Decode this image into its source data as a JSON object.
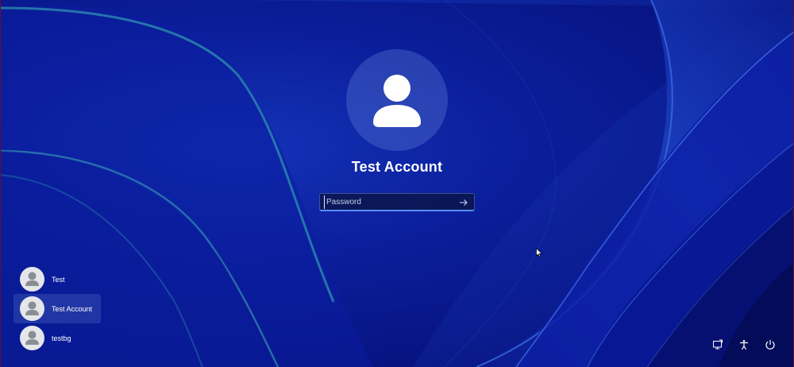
{
  "lock_screen": {
    "selected_user": {
      "name": "Test Account",
      "avatar_icon": "user-avatar-icon"
    },
    "password": {
      "placeholder": "Password",
      "value": "",
      "submit_icon": "arrow-right-icon"
    }
  },
  "user_list": [
    {
      "name": "Test",
      "avatar_icon": "user-avatar-icon",
      "selected": false
    },
    {
      "name": "Test Account",
      "avatar_icon": "user-avatar-icon",
      "selected": true
    },
    {
      "name": "testbg",
      "avatar_icon": "user-avatar-icon",
      "selected": false
    }
  ],
  "system_icons": [
    {
      "icon": "network-icon"
    },
    {
      "icon": "accessibility-icon"
    },
    {
      "icon": "power-icon"
    }
  ],
  "colors": {
    "background": "#0b1f9c",
    "accent": "#5c8dff",
    "text": "#ffffff"
  }
}
